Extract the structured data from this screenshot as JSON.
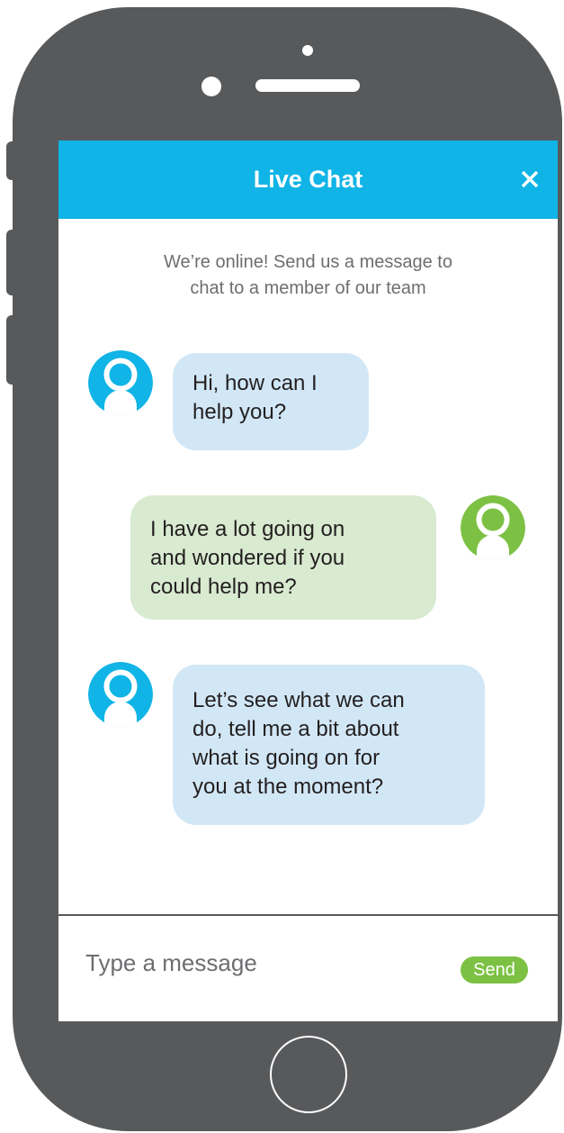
{
  "chat": {
    "title": "Live Chat",
    "close_icon": "close-icon",
    "intro_lines": [
      "We’re online! Send us a message to",
      "chat to a member of our team"
    ],
    "messages": [
      {
        "sender": "agent",
        "lines": [
          "Hi, how can I",
          "help you?"
        ]
      },
      {
        "sender": "user",
        "lines": [
          "I have a lot going on",
          "and wondered if you",
          "could help me?"
        ]
      },
      {
        "sender": "agent",
        "lines": [
          "Let’s see what we can",
          "do, tell me a bit about",
          "what is going on for",
          "you at the moment?"
        ]
      }
    ],
    "input": {
      "placeholder": "Type a message",
      "value": ""
    },
    "send_label": "Send"
  },
  "colors": {
    "header": "#10b4e6",
    "agent_avatar": "#10b4e6",
    "user_avatar": "#7dc144",
    "agent_bubble": "#d2e7f6",
    "user_bubble": "#d8ead0",
    "send_button": "#7dc144",
    "phone_body": "#58595b"
  }
}
